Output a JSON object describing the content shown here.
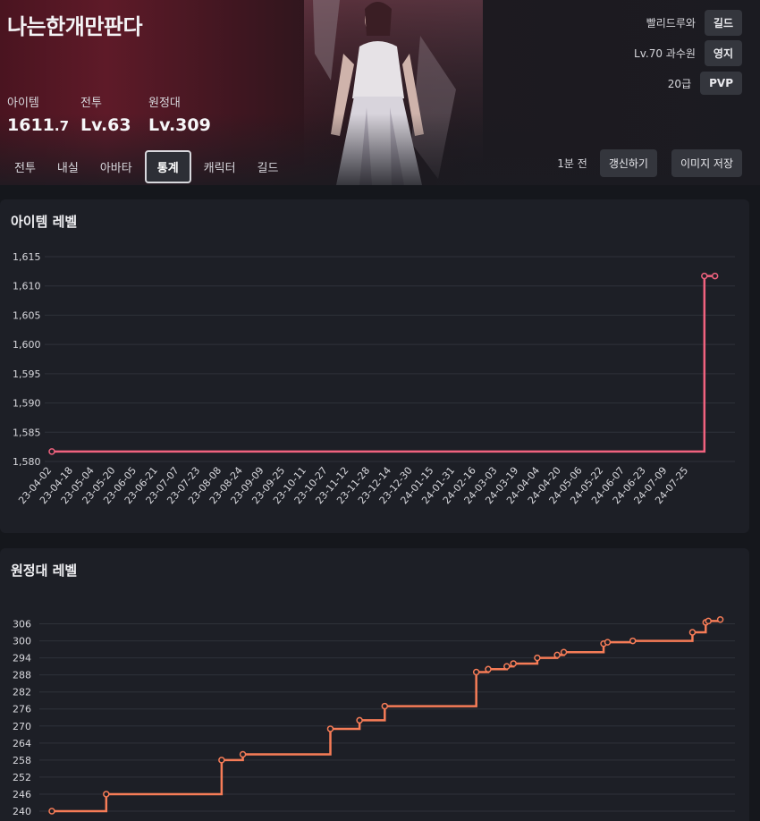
{
  "character": {
    "name": "나는한개만판다",
    "stats": [
      {
        "label": "아이템",
        "value_main": "1611",
        "value_small": ".7"
      },
      {
        "label": "전투",
        "value_main": "Lv.63",
        "value_small": ""
      },
      {
        "label": "원정대",
        "value_main": "Lv.309",
        "value_small": ""
      }
    ],
    "info": [
      {
        "text": "빨리드루와",
        "pill": "길드"
      },
      {
        "text": "Lv.70 과수원",
        "pill": "영지"
      },
      {
        "text": "20급",
        "pill": "PVP"
      }
    ]
  },
  "tabs": [
    {
      "label": "전투",
      "active": false
    },
    {
      "label": "내실",
      "active": false
    },
    {
      "label": "아바타",
      "active": false
    },
    {
      "label": "통계",
      "active": true
    },
    {
      "label": "캐릭터",
      "active": false
    },
    {
      "label": "길드",
      "active": false
    }
  ],
  "update": {
    "updated_text": "1분 전",
    "refresh_label": "갱신하기",
    "save_label": "이미지 저장"
  },
  "colors": {
    "item_line": "#f0627e",
    "roster_line": "#f67c57",
    "grid": "#2f323a",
    "axis_text": "#d8d8dd"
  },
  "chart_data": [
    {
      "type": "line",
      "title": "아이템 레벨",
      "step": true,
      "ylim": [
        1580,
        1615
      ],
      "yticks": [
        "1,580",
        "1,585",
        "1,590",
        "1,595",
        "1,600",
        "1,605",
        "1,610",
        "1,615"
      ],
      "ytick_values": [
        1580,
        1585,
        1590,
        1595,
        1600,
        1605,
        1610,
        1615
      ],
      "categories": [
        "23-04-02",
        "23-04-18",
        "23-05-04",
        "23-05-20",
        "23-06-05",
        "23-06-21",
        "23-07-07",
        "23-07-23",
        "23-08-08",
        "23-08-24",
        "23-09-09",
        "23-09-25",
        "23-10-11",
        "23-10-27",
        "23-11-12",
        "23-11-28",
        "23-12-14",
        "23-12-30",
        "24-01-15",
        "24-01-31",
        "24-02-16",
        "24-03-03",
        "24-03-19",
        "24-04-04",
        "24-04-20",
        "24-05-06",
        "24-05-22",
        "24-06-07",
        "24-06-23",
        "24-07-09",
        "24-07-25"
      ],
      "points": [
        {
          "x": "23-04-02",
          "y": 1581.7
        },
        {
          "x": "24-08-06",
          "y": 1611.7
        },
        {
          "x": "24-08-14",
          "y": 1611.7
        }
      ],
      "grid": true,
      "legend": "none"
    },
    {
      "type": "line",
      "title": "원정대 레벨",
      "step": true,
      "ylim": [
        240,
        309
      ],
      "yticks": [
        "240",
        "246",
        "252",
        "258",
        "264",
        "270",
        "276",
        "282",
        "288",
        "294",
        "300",
        "306"
      ],
      "ytick_values": [
        240,
        246,
        252,
        258,
        264,
        270,
        276,
        282,
        288,
        294,
        300,
        306
      ],
      "points": [
        {
          "x": "23-04-02",
          "y": 240
        },
        {
          "x": "23-05-13",
          "y": 246
        },
        {
          "x": "23-08-08",
          "y": 258
        },
        {
          "x": "23-08-24",
          "y": 260
        },
        {
          "x": "23-10-29",
          "y": 269
        },
        {
          "x": "23-11-20",
          "y": 272
        },
        {
          "x": "23-12-09",
          "y": 277
        },
        {
          "x": "24-02-16",
          "y": 289
        },
        {
          "x": "24-02-25",
          "y": 290
        },
        {
          "x": "24-03-10",
          "y": 291
        },
        {
          "x": "24-03-15",
          "y": 292
        },
        {
          "x": "24-04-02",
          "y": 294
        },
        {
          "x": "24-04-17",
          "y": 295
        },
        {
          "x": "24-04-22",
          "y": 296
        },
        {
          "x": "24-05-22",
          "y": 299
        },
        {
          "x": "24-05-25",
          "y": 299.5
        },
        {
          "x": "24-06-13",
          "y": 300
        },
        {
          "x": "24-07-28",
          "y": 303
        },
        {
          "x": "24-08-07",
          "y": 306.5
        },
        {
          "x": "24-08-09",
          "y": 307
        },
        {
          "x": "24-08-18",
          "y": 307.5
        }
      ],
      "grid": true,
      "legend": "none"
    }
  ]
}
